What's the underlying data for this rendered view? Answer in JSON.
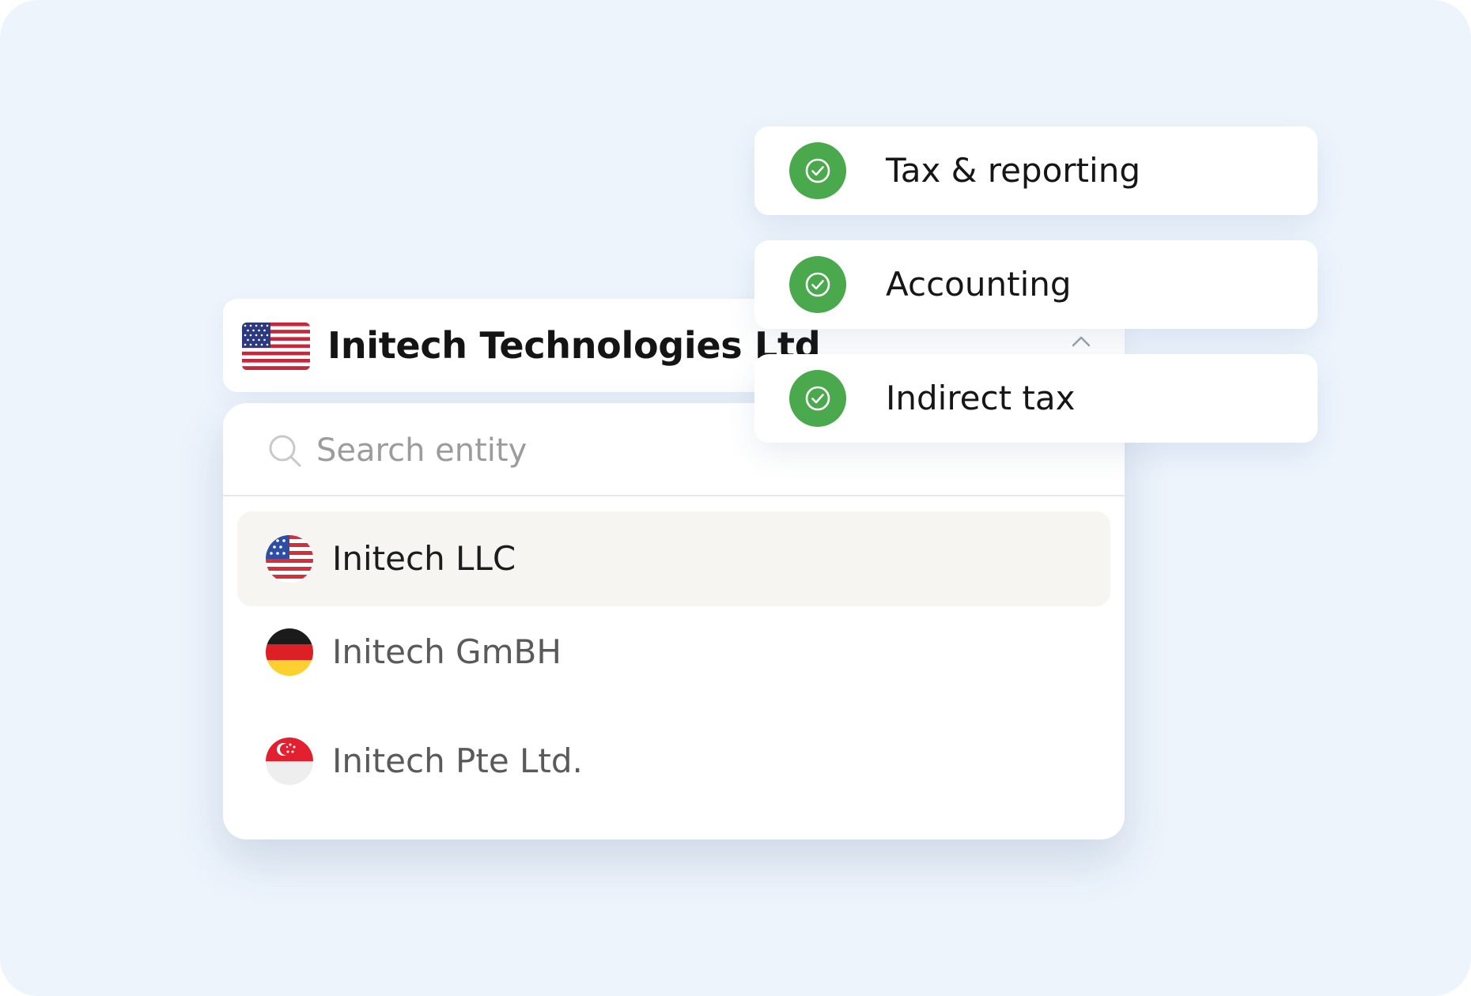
{
  "header": {
    "flag_icon": "us-flag-icon",
    "title": "Initech Technologies Ltd",
    "chevron_icon": "chevron-up-icon"
  },
  "search": {
    "icon": "search-icon",
    "placeholder": "Search entity",
    "value": ""
  },
  "entities": [
    {
      "label": "Initech LLC",
      "flag": "us-flag-icon",
      "selected": true
    },
    {
      "label": "Initech GmBH",
      "flag": "de-flag-icon",
      "selected": false
    },
    {
      "label": "Initech Pte Ltd.",
      "flag": "sg-flag-icon",
      "selected": false
    }
  ],
  "features": [
    {
      "label": "Tax & reporting",
      "icon": "check-circle-icon"
    },
    {
      "label": "Accounting",
      "icon": "check-circle-icon"
    },
    {
      "label": "Indirect tax",
      "icon": "check-circle-icon"
    }
  ],
  "colors": {
    "background": "#edf4fc",
    "check_green": "#4aa84d",
    "selected_row": "#f6f5f1"
  }
}
